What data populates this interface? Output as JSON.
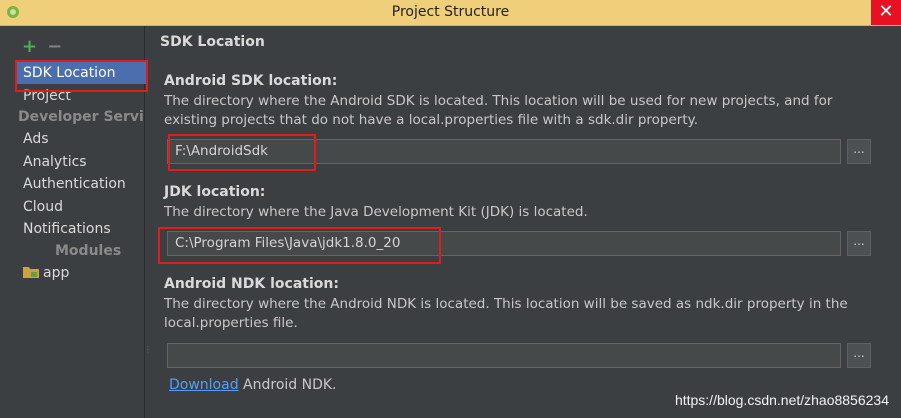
{
  "window": {
    "title": "Project Structure",
    "close_symbol": "✕"
  },
  "sidebar": {
    "add_symbol": "+",
    "remove_symbol": "−",
    "items": [
      {
        "label": "SDK Location"
      },
      {
        "label": "Project"
      }
    ],
    "developer_services_header": "Developer Services",
    "services": [
      {
        "label": "Ads"
      },
      {
        "label": "Analytics"
      },
      {
        "label": "Authentication"
      },
      {
        "label": "Cloud"
      },
      {
        "label": "Notifications"
      }
    ],
    "modules_header": "Modules",
    "modules": [
      {
        "label": "app"
      }
    ]
  },
  "main": {
    "section_title": "SDK Location",
    "android_sdk": {
      "label": "Android SDK location:",
      "desc1": "The directory where the Android SDK is located. This location will be used for new projects, and for",
      "desc2": "existing projects that do not have a local.properties file with a sdk.dir property.",
      "value": "F:\\AndroidSdk"
    },
    "jdk": {
      "label": "JDK location:",
      "desc1": "The directory where the Java Development Kit (JDK) is located.",
      "value": "C:\\Program Files\\Java\\jdk1.8.0_20"
    },
    "ndk": {
      "label": "Android NDK location:",
      "desc1": "The directory where the Android NDK is located. This location will be saved as ndk.dir property in the",
      "desc2": "local.properties file.",
      "value": ""
    },
    "browse_label": "...",
    "download_link": "Download",
    "download_suffix": " Android NDK."
  },
  "watermark": "https://blog.csdn.net/zhao8856234"
}
